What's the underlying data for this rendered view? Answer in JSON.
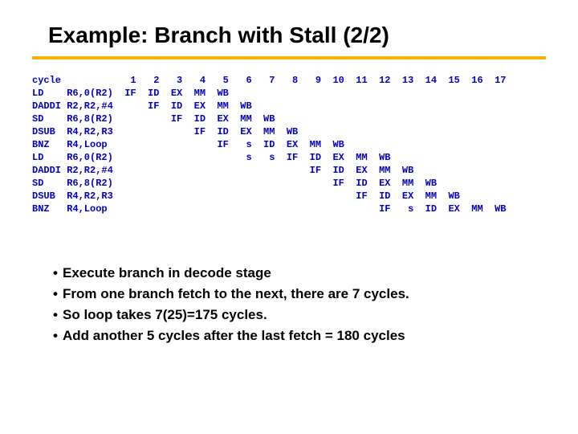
{
  "title": "Example: Branch with Stall (2/2)",
  "header": {
    "label": "cycle",
    "cycles": [
      "1",
      "2",
      "3",
      "4",
      "5",
      "6",
      "7",
      "8",
      "9",
      "10",
      "11",
      "12",
      "13",
      "14",
      "15",
      "16",
      "17"
    ]
  },
  "rows": [
    {
      "instr": "LD",
      "ops": "R6,0(R2)",
      "stages": [
        "IF",
        "ID",
        "EX",
        "MM",
        "WB",
        "",
        "",
        "",
        "",
        "",
        "",
        "",
        "",
        "",
        "",
        "",
        ""
      ]
    },
    {
      "instr": "DADDI",
      "ops": "R2,R2,#4",
      "stages": [
        "",
        "IF",
        "ID",
        "EX",
        "MM",
        "WB",
        "",
        "",
        "",
        "",
        "",
        "",
        "",
        "",
        "",
        "",
        ""
      ]
    },
    {
      "instr": "SD",
      "ops": "R6,8(R2)",
      "stages": [
        "",
        "",
        "IF",
        "ID",
        "EX",
        "MM",
        "WB",
        "",
        "",
        "",
        "",
        "",
        "",
        "",
        "",
        "",
        ""
      ]
    },
    {
      "instr": "DSUB",
      "ops": "R4,R2,R3",
      "stages": [
        "",
        "",
        "",
        "IF",
        "ID",
        "EX",
        "MM",
        "WB",
        "",
        "",
        "",
        "",
        "",
        "",
        "",
        "",
        ""
      ]
    },
    {
      "instr": "BNZ",
      "ops": "R4,Loop",
      "stages": [
        "",
        "",
        "",
        "",
        "IF",
        "s",
        "ID",
        "EX",
        "MM",
        "WB",
        "",
        "",
        "",
        "",
        "",
        "",
        ""
      ]
    },
    {
      "instr": "LD",
      "ops": "R6,0(R2)",
      "stages": [
        "",
        "",
        "",
        "",
        "",
        "s",
        "s",
        "IF",
        "ID",
        "EX",
        "MM",
        "WB",
        "",
        "",
        "",
        "",
        ""
      ]
    },
    {
      "instr": "DADDI",
      "ops": "R2,R2,#4",
      "stages": [
        "",
        "",
        "",
        "",
        "",
        "",
        "",
        "",
        "IF",
        "ID",
        "EX",
        "MM",
        "WB",
        "",
        "",
        "",
        ""
      ]
    },
    {
      "instr": "SD",
      "ops": "R6,8(R2)",
      "stages": [
        "",
        "",
        "",
        "",
        "",
        "",
        "",
        "",
        "",
        "IF",
        "ID",
        "EX",
        "MM",
        "WB",
        "",
        "",
        ""
      ]
    },
    {
      "instr": "DSUB",
      "ops": "R4,R2,R3",
      "stages": [
        "",
        "",
        "",
        "",
        "",
        "",
        "",
        "",
        "",
        "",
        "IF",
        "ID",
        "EX",
        "MM",
        "WB",
        "",
        ""
      ]
    },
    {
      "instr": "BNZ",
      "ops": "R4,Loop",
      "stages": [
        "",
        "",
        "",
        "",
        "",
        "",
        "",
        "",
        "",
        "",
        "",
        "IF",
        "s",
        "ID",
        "EX",
        "MM",
        "WB"
      ]
    }
  ],
  "bullets": [
    "Execute branch in decode stage",
    "From one branch fetch to the next, there are 7 cycles.",
    "So loop takes 7(25)=175 cycles.",
    "Add another 5 cycles after the last fetch = 180 cycles"
  ],
  "chart_data": {
    "type": "table",
    "title": "Pipeline cycle diagram — Branch with Stall",
    "columns": [
      "instruction",
      "operands",
      "1",
      "2",
      "3",
      "4",
      "5",
      "6",
      "7",
      "8",
      "9",
      "10",
      "11",
      "12",
      "13",
      "14",
      "15",
      "16",
      "17"
    ],
    "rows": [
      [
        "LD",
        "R6,0(R2)",
        "IF",
        "ID",
        "EX",
        "MM",
        "WB",
        "",
        "",
        "",
        "",
        "",
        "",
        "",
        "",
        "",
        "",
        "",
        ""
      ],
      [
        "DADDI",
        "R2,R2,#4",
        "",
        "IF",
        "ID",
        "EX",
        "MM",
        "WB",
        "",
        "",
        "",
        "",
        "",
        "",
        "",
        "",
        "",
        "",
        ""
      ],
      [
        "SD",
        "R6,8(R2)",
        "",
        "",
        "IF",
        "ID",
        "EX",
        "MM",
        "WB",
        "",
        "",
        "",
        "",
        "",
        "",
        "",
        "",
        "",
        ""
      ],
      [
        "DSUB",
        "R4,R2,R3",
        "",
        "",
        "",
        "IF",
        "ID",
        "EX",
        "MM",
        "WB",
        "",
        "",
        "",
        "",
        "",
        "",
        "",
        "",
        ""
      ],
      [
        "BNZ",
        "R4,Loop",
        "",
        "",
        "",
        "",
        "IF",
        "s",
        "ID",
        "EX",
        "MM",
        "WB",
        "",
        "",
        "",
        "",
        "",
        "",
        ""
      ],
      [
        "LD",
        "R6,0(R2)",
        "",
        "",
        "",
        "",
        "",
        "s",
        "s",
        "IF",
        "ID",
        "EX",
        "MM",
        "WB",
        "",
        "",
        "",
        "",
        ""
      ],
      [
        "DADDI",
        "R2,R2,#4",
        "",
        "",
        "",
        "",
        "",
        "",
        "",
        "",
        "IF",
        "ID",
        "EX",
        "MM",
        "WB",
        "",
        "",
        "",
        ""
      ],
      [
        "SD",
        "R6,8(R2)",
        "",
        "",
        "",
        "",
        "",
        "",
        "",
        "",
        "",
        "IF",
        "ID",
        "EX",
        "MM",
        "WB",
        "",
        "",
        ""
      ],
      [
        "DSUB",
        "R4,R2,R3",
        "",
        "",
        "",
        "",
        "",
        "",
        "",
        "",
        "",
        "",
        "IF",
        "ID",
        "EX",
        "MM",
        "WB",
        "",
        ""
      ],
      [
        "BNZ",
        "R4,Loop",
        "",
        "",
        "",
        "",
        "",
        "",
        "",
        "",
        "",
        "",
        "",
        "IF",
        "s",
        "ID",
        "EX",
        "MM",
        "WB"
      ]
    ]
  }
}
